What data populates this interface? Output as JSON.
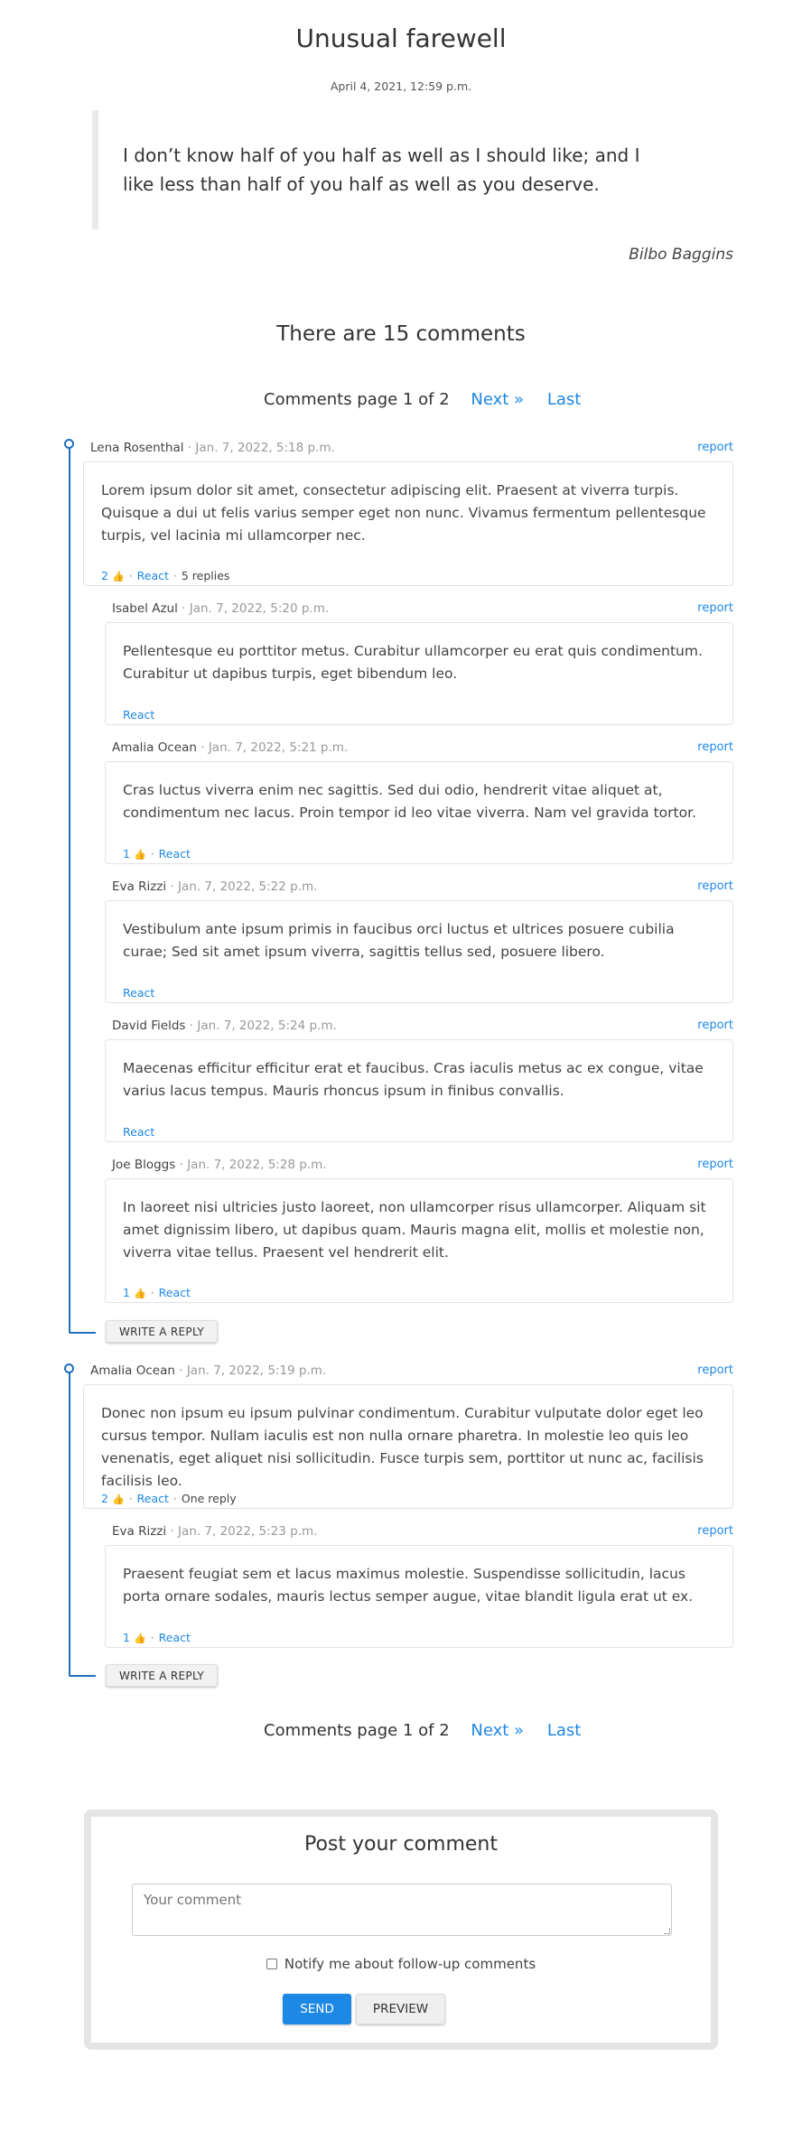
{
  "article": {
    "title": "Unusual farewell",
    "date": "April 4, 2021, 12:59 p.m.",
    "quote": "I don’t know half of you half as well as I should like; and I like less than half of you half as well as you deserve.",
    "author": "Bilbo Baggins"
  },
  "comments_count_text": "There are 15 comments",
  "pagination": {
    "text": "Comments page 1 of 2",
    "next": "Next »",
    "last": "Last"
  },
  "labels": {
    "report": "report",
    "react": "React",
    "write_reply": "WRITE A REPLY"
  },
  "threads": [
    {
      "comment": {
        "author": "Lena Rosenthal",
        "date": "Jan. 7, 2022, 5:18 p.m.",
        "text": "Lorem ipsum dolor sit amet, consectetur adipiscing elit. Praesent at viverra turpis. Quisque a dui ut felis varius semper eget non nunc. Vivamus fermentum pellentesque turpis, vel lacinia mi ullamcorper nec.",
        "likes": "2",
        "replies": "5 replies"
      },
      "replies": [
        {
          "author": "Isabel Azul",
          "date": "Jan. 7, 2022, 5:20 p.m.",
          "text": "Pellentesque eu porttitor metus. Curabitur ullamcorper eu erat quis condimentum. Curabitur ut dapibus turpis, eget bibendum leo."
        },
        {
          "author": "Amalia Ocean",
          "date": "Jan. 7, 2022, 5:21 p.m.",
          "text": "Cras luctus viverra enim nec sagittis. Sed dui odio, hendrerit vitae aliquet at, condimentum nec lacus. Proin tempor id leo vitae viverra. Nam vel gravida tortor.",
          "likes": "1"
        },
        {
          "author": "Eva Rizzi",
          "date": "Jan. 7, 2022, 5:22 p.m.",
          "text": "Vestibulum ante ipsum primis in faucibus orci luctus et ultrices posuere cubilia curae; Sed sit amet ipsum viverra, sagittis tellus sed, posuere libero."
        },
        {
          "author": "David Fields",
          "date": "Jan. 7, 2022, 5:24 p.m.",
          "text": "Maecenas efficitur efficitur erat et faucibus. Cras iaculis metus ac ex congue, vitae varius lacus tempus. Mauris rhoncus ipsum in finibus convallis."
        },
        {
          "author": "Joe Bloggs",
          "date": "Jan. 7, 2022, 5:28 p.m.",
          "text": "In laoreet nisi ultricies justo laoreet, non ullamcorper risus ullamcorper. Aliquam sit amet dignissim libero, ut dapibus quam. Mauris magna elit, mollis et molestie non, viverra vitae tellus. Praesent vel hendrerit elit.",
          "likes": "1"
        }
      ]
    },
    {
      "comment": {
        "author": "Amalia Ocean",
        "date": "Jan. 7, 2022, 5:19 p.m.",
        "text": "Donec non ipsum eu ipsum pulvinar condimentum. Curabitur vulputate dolor eget leo cursus tempor. Nullam iaculis est non nulla ornare pharetra. In molestie leo quis leo venenatis, eget aliquet nisi sollicitudin. Fusce turpis sem, porttitor ut nunc ac, facilisis facilisis leo.",
        "likes": "2",
        "replies": "One reply"
      },
      "replies": [
        {
          "author": "Eva Rizzi",
          "date": "Jan. 7, 2022, 5:23 p.m.",
          "text": "Praesent feugiat sem et lacus maximus molestie. Suspendisse sollicitudin, lacus porta ornare sodales, mauris lectus semper augue, vitae blandit ligula erat ut ex.",
          "likes": "1"
        }
      ]
    }
  ],
  "post_form": {
    "title": "Post your comment",
    "placeholder": "Your comment",
    "notify_label": "Notify me about follow-up comments",
    "send": "SEND",
    "preview": "PREVIEW"
  },
  "colors": {
    "accent": "#1e88e5",
    "thread_line": "#1e6fbf"
  }
}
